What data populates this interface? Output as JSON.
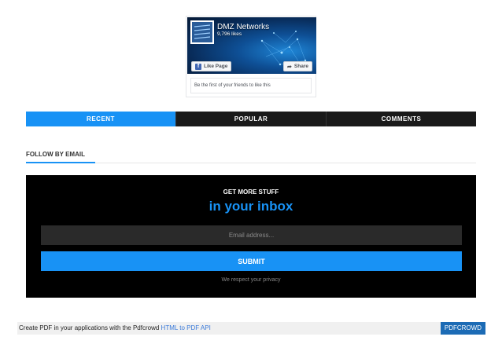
{
  "facebook_widget": {
    "page_name": "DMZ Networks",
    "likes": "9,796 likes",
    "like_button": "Like Page",
    "share_button": "Share",
    "friends_text": "Be the first of your friends to like this"
  },
  "tabs": [
    {
      "label": "RECENT",
      "active": true
    },
    {
      "label": "POPULAR",
      "active": false
    },
    {
      "label": "COMMENTS",
      "active": false
    }
  ],
  "follow_by_email": {
    "title": "FOLLOW BY EMAIL",
    "kicker": "GET MORE STUFF",
    "headline": "in your inbox",
    "email_placeholder": "Email address...",
    "submit_label": "SUBMIT",
    "privacy_note": "We respect your privacy"
  },
  "pdf_footer": {
    "text": "Create PDF in your applications with the Pdfcrowd",
    "link_text": "HTML to PDF API",
    "brand": "PDFCROWD"
  },
  "colors": {
    "accent": "#1892f5",
    "tab_dark": "#1a1a1a",
    "box_bg": "#000000"
  }
}
